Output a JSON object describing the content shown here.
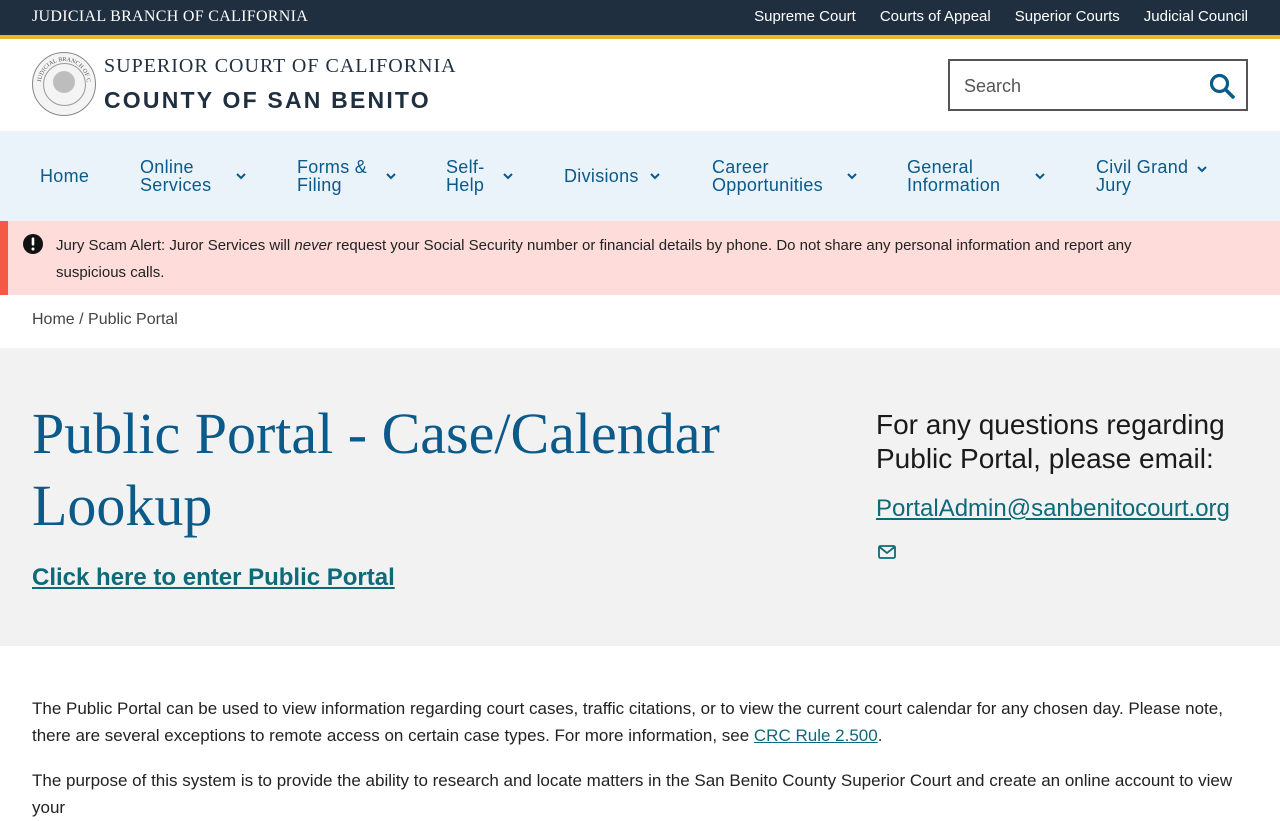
{
  "topbar": {
    "branch_title": "JUDICIAL BRANCH OF CALIFORNIA",
    "links": [
      "Supreme Court",
      "Courts of Appeal",
      "Superior Courts",
      "Judicial Council"
    ]
  },
  "header": {
    "seal_text": "JUDICIAL BRANCH OF CALIFORNIA",
    "line1": "SUPERIOR COURT OF CALIFORNIA",
    "line2": "COUNTY OF SAN BENITO",
    "search_placeholder": "Search"
  },
  "nav": {
    "items": [
      {
        "label": "Home"
      },
      {
        "label": "Online Services"
      },
      {
        "label": "Forms & Filing"
      },
      {
        "label": "Self-Help"
      },
      {
        "label": "Divisions"
      },
      {
        "label": "Career Opportunities"
      },
      {
        "label": "General Information"
      },
      {
        "label": "Civil Grand Jury"
      }
    ]
  },
  "alert": {
    "prefix": "Jury Scam Alert: Juror Services will ",
    "emphasis": "never",
    "suffix": " request your Social Security number or financial details by phone. Do not share any personal information and report any suspicious calls."
  },
  "breadcrumb": {
    "home": "Home",
    "separator": " / ",
    "current": "Public Portal"
  },
  "hero": {
    "title": "Public Portal - Case/Calendar Lookup",
    "enter_link": "Click here to enter Public Portal",
    "question": "For any questions regarding Public Portal, please email:",
    "email": "PortalAdmin@sanbenitocourt.org"
  },
  "body": {
    "p1_text": "The Public Portal can be used to view information regarding court cases, traffic citations, or to view the current court calendar for any chosen day. Please note, there are several exceptions to remote access on certain case types. For more information, see ",
    "p1_link": "CRC Rule 2.500",
    "p1_end": ".",
    "p2_text": "The purpose of this system is to provide the ability to research and locate matters in the San Benito County Superior Court and create an online account to view your"
  },
  "colors": {
    "topbar_bg": "#1f2f3f",
    "accent_gold": "#f0b323",
    "nav_bg": "#eaf3fa",
    "nav_text": "#0a5a8a",
    "alert_bg": "#fddcd9",
    "alert_border": "#f25a45",
    "hero_bg": "#f2f2f2",
    "link": "#0d6a78"
  },
  "icons": {
    "search": "search-icon",
    "alert": "exclamation-circle-icon",
    "chevron": "chevron-down-icon",
    "mail": "envelope-icon"
  }
}
